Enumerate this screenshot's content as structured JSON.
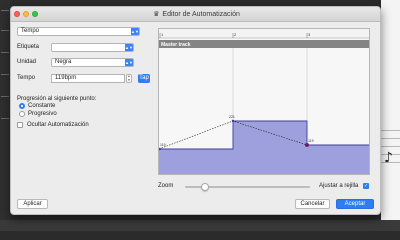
{
  "window": {
    "title": "Editor de Automatización",
    "title_icon": "app-icon"
  },
  "form": {
    "type_select": "Tempo",
    "etiqueta_label": "Etiqueta",
    "etiqueta_value": "",
    "unidad_label": "Unidad",
    "unidad_value": "Negra",
    "tempo_label": "Tempo",
    "tempo_value": "119bpm",
    "tap_label": "Tap",
    "progression_heading": "Progresión al siguiente punto:",
    "radio_constante": "Constante",
    "radio_progresivo": "Progresivo",
    "radio_selected": "Constante",
    "hide_label": "Ocultar Automatización",
    "hide_checked": false
  },
  "graph": {
    "track_label": "Master track",
    "ruler": [
      "1",
      "2",
      "3"
    ],
    "point_labels": [
      "119",
      "221",
      "119"
    ],
    "fill_color": "#9e9fdd",
    "line_color": "#3b3f9e",
    "point_color": "#6a1f6a"
  },
  "zoom": {
    "label": "Zoom",
    "value": 0.14,
    "snap_label": "Ajustar a rejilla",
    "snap_checked": true
  },
  "buttons": {
    "apply": "Aplicar",
    "cancel": "Cancelar",
    "ok": "Aceptar"
  }
}
